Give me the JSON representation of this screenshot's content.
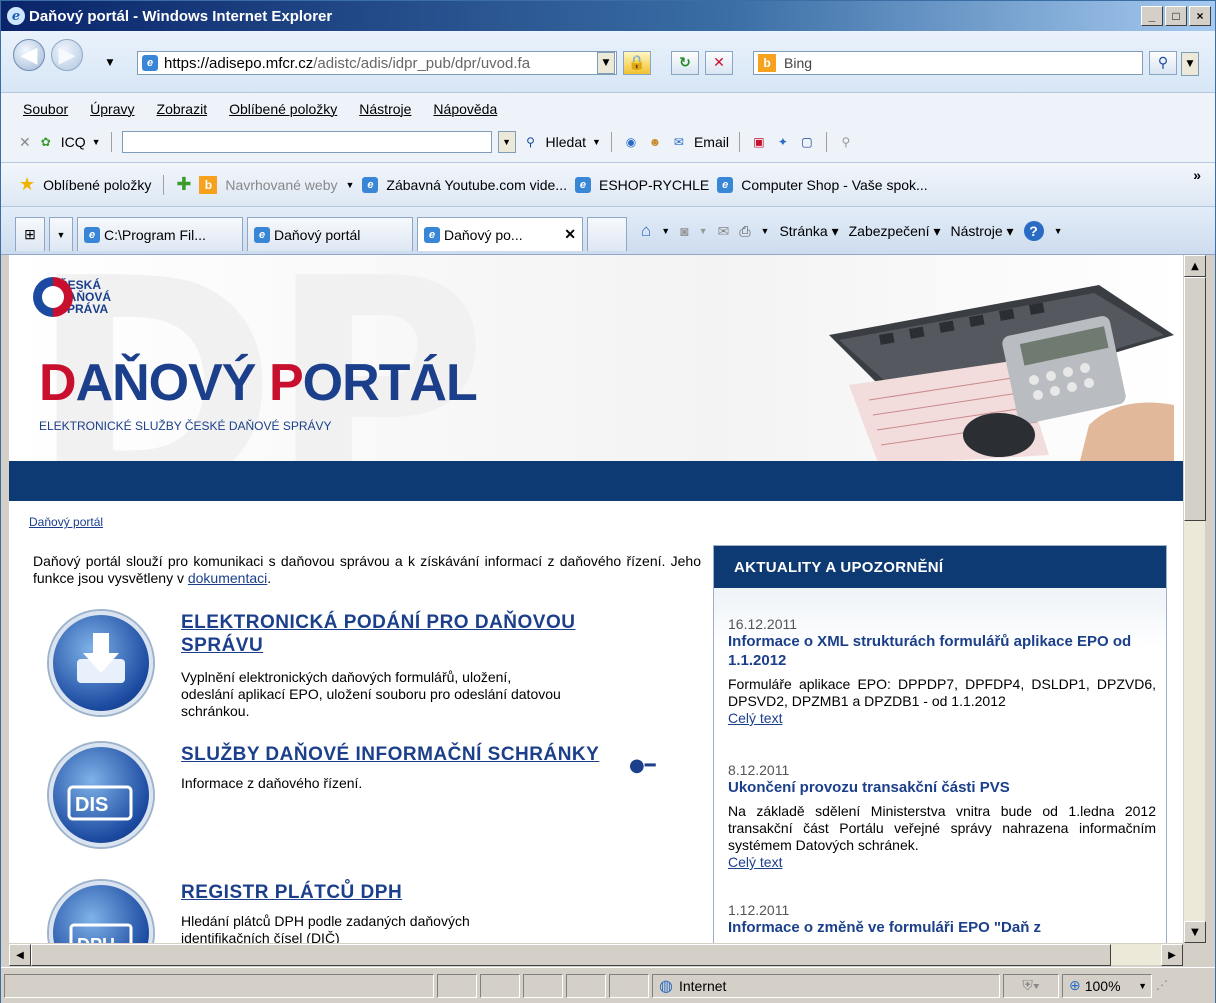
{
  "window": {
    "title": "Daňový portál - Windows Internet Explorer",
    "btn_min": "_",
    "btn_max": "□",
    "btn_close": "×"
  },
  "address": {
    "prefix": "https://adisepo.",
    "domain": "mfcr.cz",
    "path": "/adistc/adis/idpr_pub/dpr/uvod.fa"
  },
  "search": {
    "placeholder": "Bing"
  },
  "menu": [
    "Soubor",
    "Úpravy",
    "Zobrazit",
    "Oblíbené položky",
    "Nástroje",
    "Nápověda"
  ],
  "toolbar": {
    "icq_label": "ICQ",
    "hledat_label": "Hledat",
    "email_label": "Email"
  },
  "favorites": {
    "label": "Oblíbené položky",
    "items": [
      "Navrhované weby",
      "Zábavná Youtube.com vide...",
      "ESHOP-RYCHLE",
      "Computer Shop - Vaše spok..."
    ],
    "more": "»"
  },
  "tabs": [
    {
      "label": "C:\\Program Fil..."
    },
    {
      "label": "Daňový portál"
    },
    {
      "label": "Daňový po..."
    }
  ],
  "commandbar": {
    "page": "Stránka",
    "security": "Zabezpečení",
    "tools": "Nástroje",
    "help": "?"
  },
  "banner": {
    "logo_lines": [
      "ČESKÁ",
      "DAŇOVÁ",
      "SPRÁVA"
    ],
    "title_d": "D",
    "title_1": "AŇOVÝ ",
    "title_p": "P",
    "title_2": "ORTÁL",
    "subtitle": "ELEKTRONICKÉ SLUŽBY ČESKÉ DAŇOVÉ SPRÁVY",
    "watermark": "DP"
  },
  "breadcrumb": "Daňový portál",
  "intro": {
    "text": "Daňový portál slouží pro komunikaci s daňovou správou a k získávání informací z daňového řízení. Jeho funkce jsou vysvětleny v ",
    "link": "dokumentaci",
    "end": "."
  },
  "services": [
    {
      "title": "ELEKTRONICKÁ PODÁNÍ PRO DAŇOVOU SPRÁVU",
      "desc": "Vyplnění elektronických daňových formulářů, uložení, odeslání aplikací EPO, uložení souboru pro odeslání datovou schránkou.",
      "icon": "download-icon"
    },
    {
      "title": "SLUŽBY DAŇOVÉ INFORMAČNÍ SCHRÁNKY",
      "desc": "Informace z daňového řízení.",
      "icon": "DIS"
    },
    {
      "title": "REGISTR PLÁTCŮ DPH",
      "desc": "Hledání plátců DPH podle zadaných daňových identifikačních čísel (DIČ)",
      "icon": "DPH"
    }
  ],
  "news": {
    "header": "AKTUALITY A UPOZORNĚNÍ",
    "items": [
      {
        "date": "16.12.2011",
        "title": "Informace o XML strukturách formulářů aplikace EPO od 1.1.2012",
        "body": "Formuláře aplikace EPO: DPPDP7, DPFDP4, DSLDP1, DPZVD6, DPSVD2, DPZMB1 a DPZDB1 - od 1.1.2012",
        "more": "Celý text"
      },
      {
        "date": "8.12.2011",
        "title": "Ukončení provozu transakční části PVS",
        "body": "Na základě sdělení Ministerstva vnitra bude od 1.ledna 2012 transakční část Portálu veřejné správy nahrazena informačním systémem Datových schránek.",
        "more": "Celý text"
      },
      {
        "date": "1.12.2011",
        "title": "Informace o změně ve formuláři EPO \"Daň z",
        "body": "",
        "more": ""
      }
    ]
  },
  "status": {
    "zone": "Internet",
    "zoom": "100%"
  }
}
